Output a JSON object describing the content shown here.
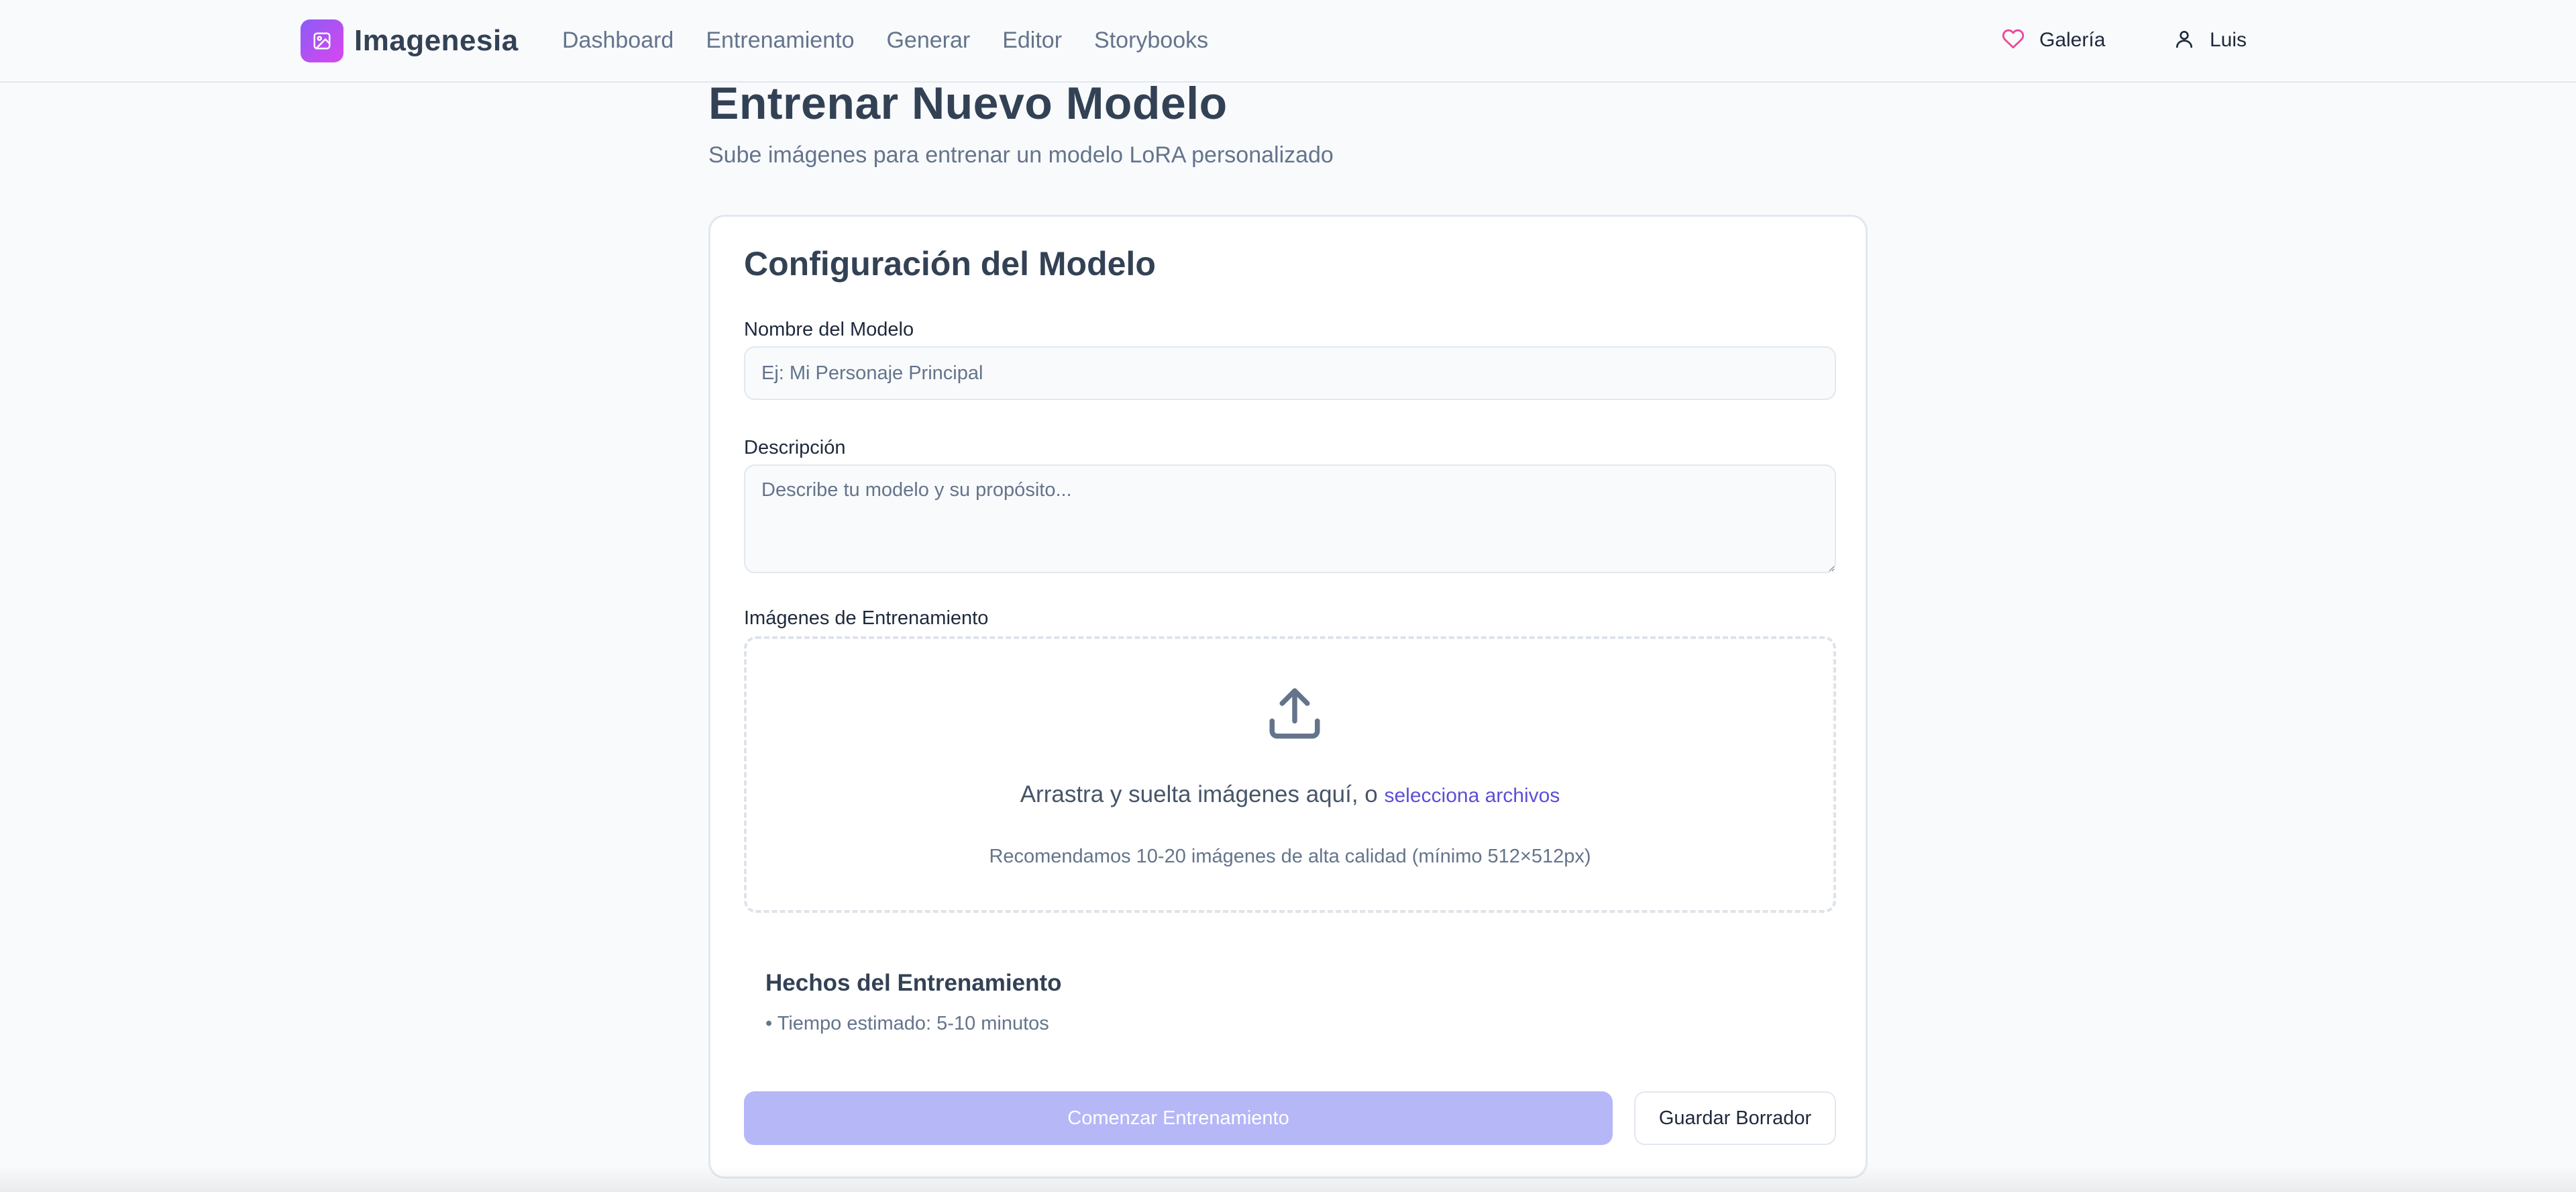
{
  "app": {
    "name": "Imagenesia",
    "logo_icon": "image-icon",
    "accent": "#8b5cf6"
  },
  "nav": {
    "links": [
      "Dashboard",
      "Entrenamiento",
      "Generar",
      "Editor",
      "Storybooks"
    ],
    "gallery_label": "Galería",
    "gallery_icon": "heart-icon",
    "user_label": "Luis",
    "user_icon": "user-icon"
  },
  "page": {
    "title": "Entrenar Nuevo Modelo",
    "subtitle": "Sube imágenes para entrenar un modelo LoRA personalizado"
  },
  "form": {
    "card_title": "Configuración del Modelo",
    "name_label": "Nombre del Modelo",
    "name_placeholder": "Ej: Mi Personaje Principal",
    "name_value": "",
    "description_label": "Descripción",
    "description_placeholder": "Describe tu modelo y su propósito...",
    "description_value": "",
    "images_label": "Imágenes de Entrenamiento",
    "upload_icon": "upload-icon",
    "dropzone_text": "Arrastra y suelta imágenes aquí, o",
    "dropzone_link": "selecciona archivos",
    "dropzone_hint": "Recomendamos 10-20 imágenes de alta calidad (mínimo 512×512px)"
  },
  "facts": {
    "title": "Hechos del Entrenamiento",
    "items": [
      "Tiempo estimado: 5-10 minutos"
    ]
  },
  "actions": {
    "start_label": "Comenzar Entrenamiento",
    "start_disabled": true,
    "draft_label": "Guardar Borrador"
  },
  "colors": {
    "primary_button_disabled": "#b6b7f7",
    "link": "#5b4fd6",
    "heart": "#ec4899"
  }
}
